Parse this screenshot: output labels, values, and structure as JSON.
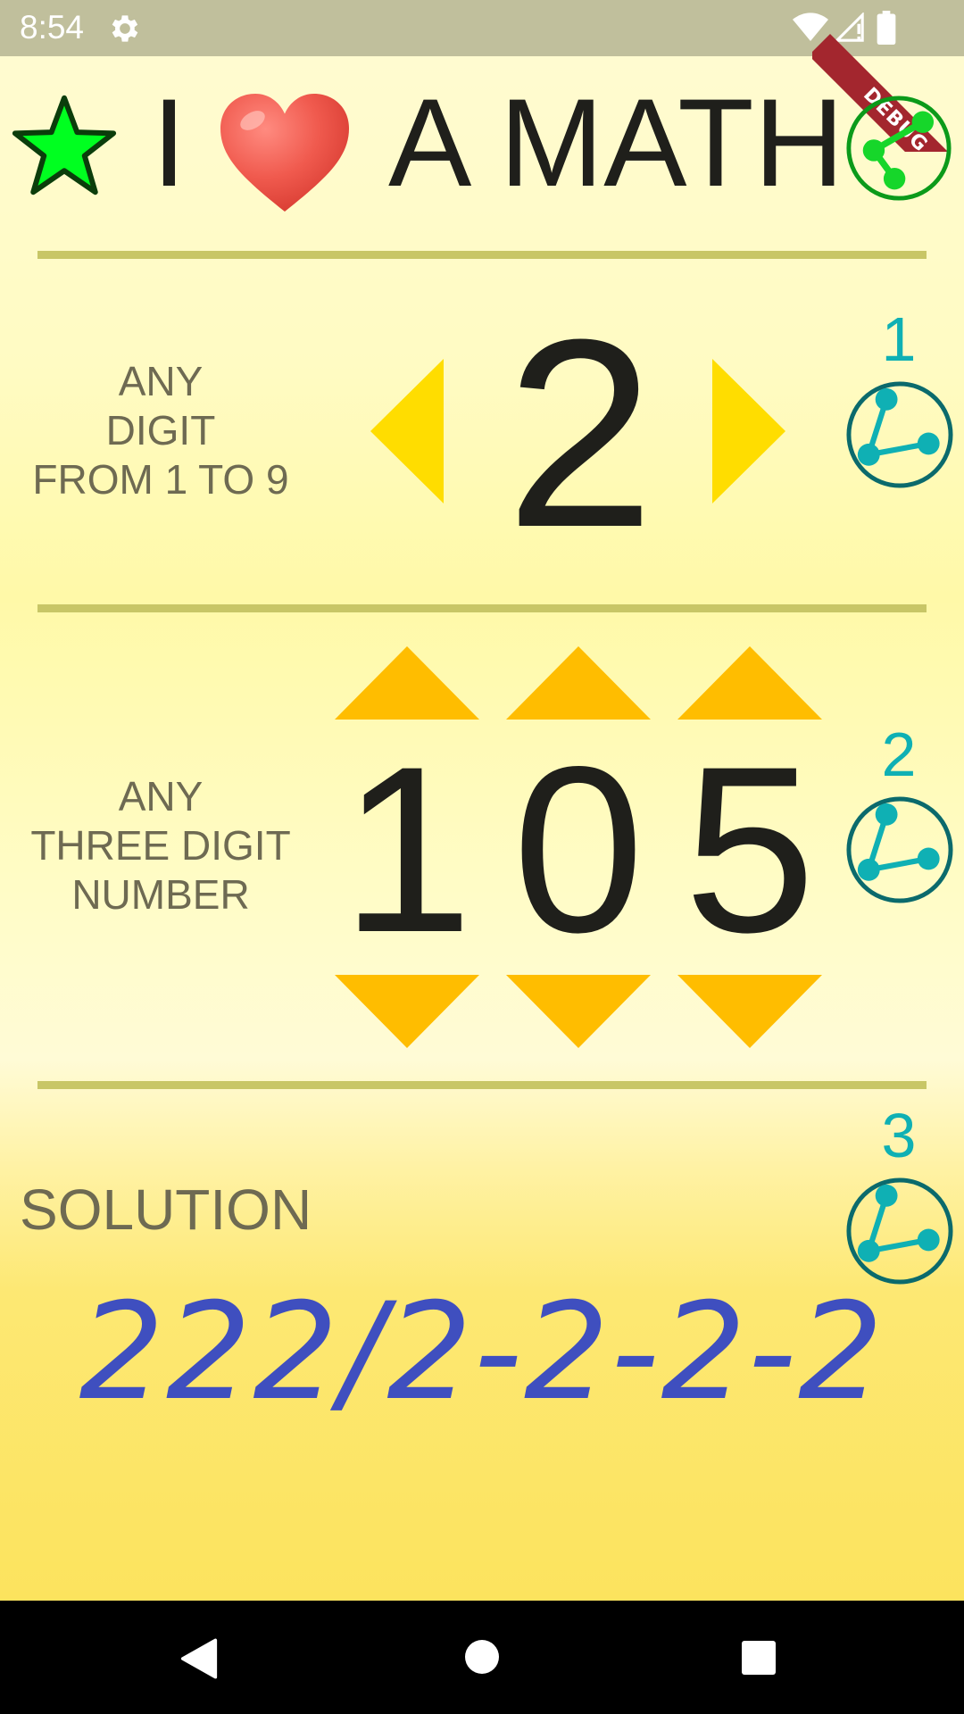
{
  "status_bar": {
    "time": "8:54",
    "icons": [
      "settings-icon",
      "wifi-icon",
      "signal-icon",
      "battery-icon"
    ]
  },
  "debug_banner": {
    "label": "DEBUG"
  },
  "header": {
    "title_part1": "I",
    "title_part2": "A MATH",
    "heart_icon": "heart-icon",
    "star_icon": "star-icon",
    "share_icon": "share-icon"
  },
  "section1": {
    "label_lines": [
      "ANY",
      "DIGIT",
      "FROM 1 TO 9"
    ],
    "digit": "2",
    "badge_number": "1"
  },
  "section2": {
    "label_lines": [
      "ANY",
      "THREE DIGIT",
      "NUMBER"
    ],
    "digits": [
      "1",
      "0",
      "5"
    ],
    "badge_number": "2"
  },
  "section3": {
    "label": "SOLUTION",
    "solution": "222/2-2-2-2",
    "badge_number": "3"
  },
  "colors": {
    "star_fill": "#00ff20",
    "heart": "#f05a4e",
    "share_green": "#16d62a",
    "badge_teal": "#0fb0b4",
    "arrow_yellow": "#ffdd00",
    "arrow_amber": "#ffbd00",
    "solution_blue": "#3f4fbf",
    "divider": "#c8c666"
  }
}
